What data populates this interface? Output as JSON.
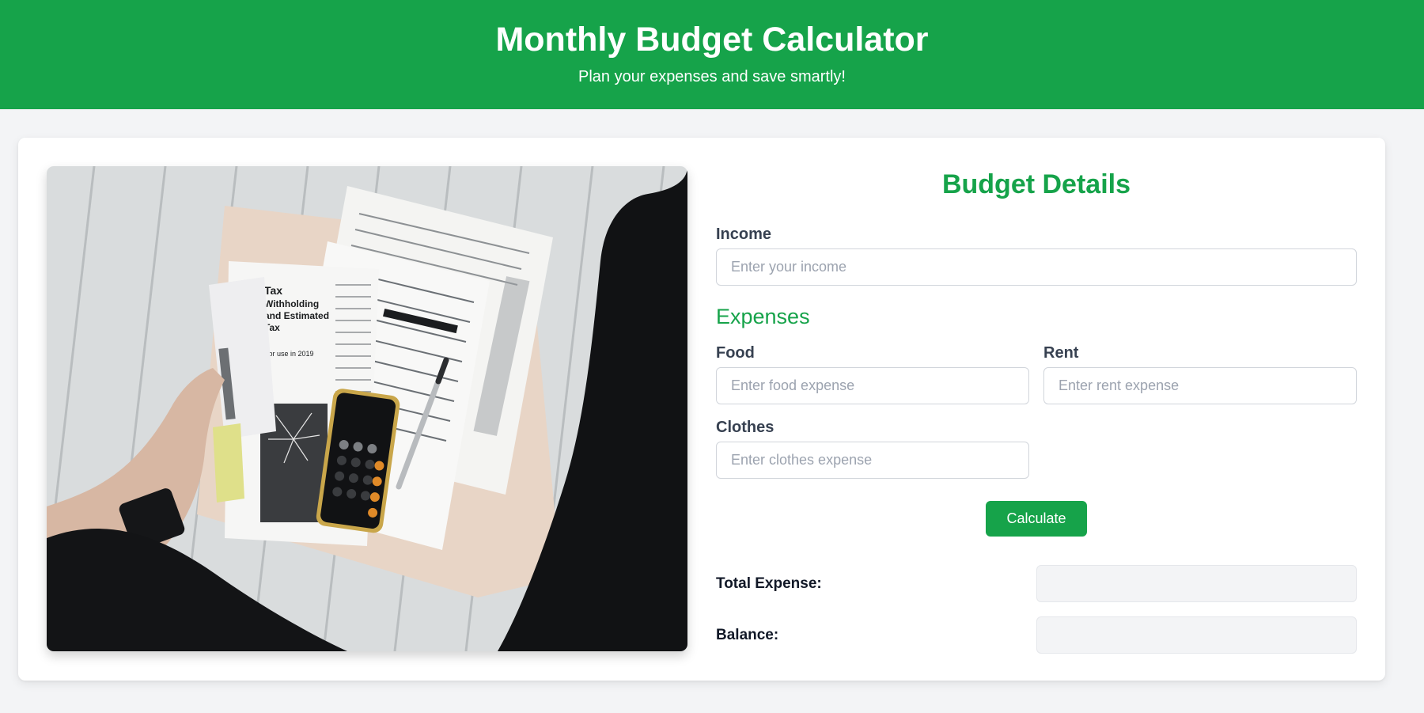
{
  "header": {
    "title": "Monthly Budget Calculator",
    "subtitle": "Plan your expenses and save smartly!"
  },
  "form": {
    "heading": "Budget Details",
    "income": {
      "label": "Income",
      "placeholder": "Enter your income",
      "value": ""
    },
    "expenses_heading": "Expenses",
    "food": {
      "label": "Food",
      "placeholder": "Enter food expense",
      "value": ""
    },
    "rent": {
      "label": "Rent",
      "placeholder": "Enter rent expense",
      "value": ""
    },
    "clothes": {
      "label": "Clothes",
      "placeholder": "Enter clothes expense",
      "value": ""
    },
    "calculate_label": "Calculate",
    "total_expense": {
      "label": "Total Expense:",
      "value": ""
    },
    "balance": {
      "label": "Balance:",
      "value": ""
    }
  },
  "image": {
    "subject": "tax documents, calculator phone and pen on white wooden floor",
    "document_title": "Tax Withholding and Estimated Tax",
    "document_year": "2019"
  },
  "colors": {
    "accent": "#16a34a",
    "page_bg": "#f3f4f6",
    "card_bg": "#ffffff"
  }
}
